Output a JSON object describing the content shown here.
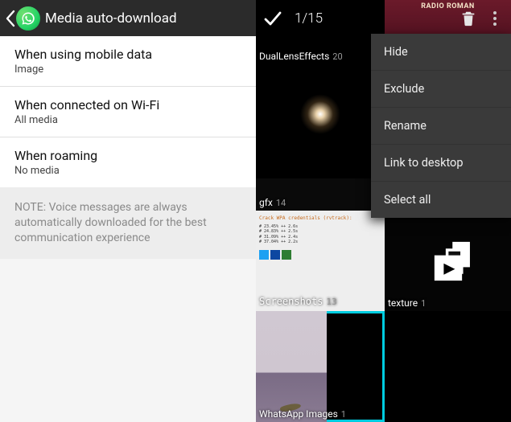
{
  "left": {
    "header_title": "Media auto-download",
    "settings": [
      {
        "title": "When using mobile data",
        "sub": "Image"
      },
      {
        "title": "When connected on Wi-Fi",
        "sub": "All media"
      },
      {
        "title": "When roaming",
        "sub": "No media"
      }
    ],
    "note": "NOTE: Voice messages are always automatically downloaded for the best communication experience"
  },
  "right": {
    "selection_count": "1/15",
    "radio_text": "RADIO ROMAN",
    "albums": [
      {
        "name": "DualLensEffects",
        "count": "20"
      },
      {
        "name": "gfx",
        "count": "14"
      },
      {
        "name": "Screenshots",
        "count": "13"
      },
      {
        "name": "texture",
        "count": "1"
      },
      {
        "name": "WhatsApp Images",
        "count": "1"
      }
    ],
    "screenshot_preview": {
      "line_top": "Crack WPA credentials (rvtrack):",
      "line1": "#  23.45% ++ 2.6s",
      "line2": "#  24.83% ++ 2.5s",
      "line3": "#  31.09% ++ 2.4s",
      "line4": "#  37.04% ++ 2.2s"
    },
    "menu": {
      "items": [
        "Hide",
        "Exclude",
        "Rename",
        "Link to desktop",
        "Select all"
      ]
    }
  }
}
